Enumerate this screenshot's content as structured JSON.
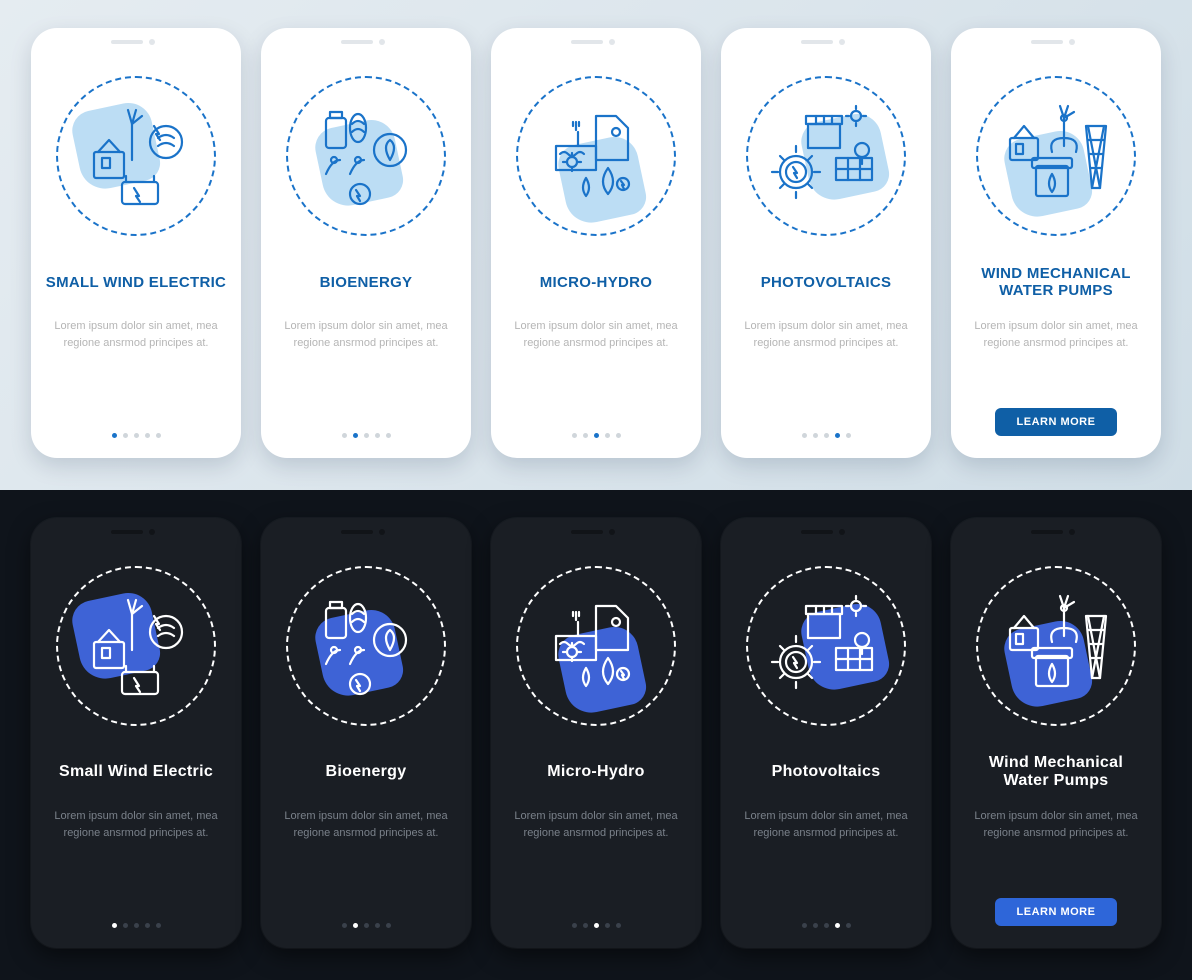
{
  "lorem": "Lorem ipsum dolor sin amet, mea regione ansrmod principes at.",
  "button_label": "LEARN MORE",
  "cards": [
    {
      "title_light": "SMALL WIND ELECTRIC",
      "title_dark": "Small Wind Electric",
      "active": 0,
      "icon": "wind"
    },
    {
      "title_light": "BIOENERGY",
      "title_dark": "Bioenergy",
      "active": 1,
      "icon": "bio"
    },
    {
      "title_light": "MICRO-HYDRO",
      "title_dark": "Micro-Hydro",
      "active": 2,
      "icon": "hydro"
    },
    {
      "title_light": "PHOTOVOLTAICS",
      "title_dark": "Photovoltaics",
      "active": 3,
      "icon": "solar"
    },
    {
      "title_light": "WIND MECHANICAL WATER PUMPS",
      "title_dark": "Wind Mechanical Water Pumps",
      "active": 4,
      "icon": "pump",
      "button": true
    }
  ],
  "dot_count": 5,
  "colors": {
    "light_accent": "#1a73c9",
    "dark_accent": "#3e63d6"
  }
}
